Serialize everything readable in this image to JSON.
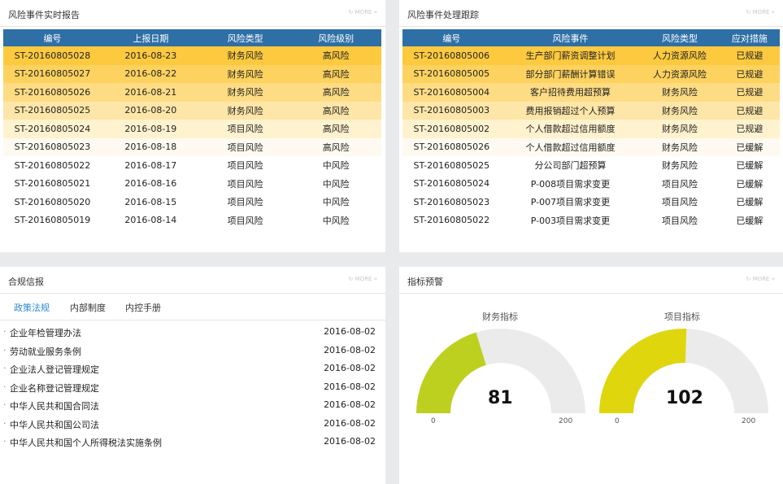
{
  "colors": {
    "header_bg": "#2e6fa6",
    "row_shades": [
      "#fcc93f",
      "#fdd25e",
      "#fedc84",
      "#fee6a8",
      "#fff2cf",
      "#fffaf1"
    ],
    "gauge_finance": "#bed01f",
    "gauge_project": "#dfd60e",
    "gauge_track": "#ebebeb"
  },
  "more_label": "MORE",
  "risk_report": {
    "title": "风险事件实时报告",
    "columns": [
      "编号",
      "上报日期",
      "风险类型",
      "风险级别"
    ],
    "rows": [
      [
        "ST-20160805028",
        "2016-08-23",
        "财务风险",
        "高风险"
      ],
      [
        "ST-20160805027",
        "2016-08-22",
        "财务风险",
        "高风险"
      ],
      [
        "ST-20160805026",
        "2016-08-21",
        "财务风险",
        "高风险"
      ],
      [
        "ST-20160805025",
        "2016-08-20",
        "财务风险",
        "高风险"
      ],
      [
        "ST-20160805024",
        "2016-08-19",
        "项目风险",
        "高风险"
      ],
      [
        "ST-20160805023",
        "2016-08-18",
        "项目风险",
        "高风险"
      ],
      [
        "ST-20160805022",
        "2016-08-17",
        "项目风险",
        "中风险"
      ],
      [
        "ST-20160805021",
        "2016-08-16",
        "项目风险",
        "中风险"
      ],
      [
        "ST-20160805020",
        "2016-08-15",
        "项目风险",
        "中风险"
      ],
      [
        "ST-20160805019",
        "2016-08-14",
        "项目风险",
        "中风险"
      ]
    ]
  },
  "risk_tracking": {
    "title": "风险事件处理跟踪",
    "columns": [
      "编号",
      "风险事件",
      "风险类型",
      "应对措施"
    ],
    "rows": [
      [
        "ST-20160805006",
        "生产部门薪资调整计划",
        "人力资源风险",
        "已规避"
      ],
      [
        "ST-20160805005",
        "部分部门薪酬计算错误",
        "人力资源风险",
        "已规避"
      ],
      [
        "ST-20160805004",
        "客户招待费用超预算",
        "财务风险",
        "已规避"
      ],
      [
        "ST-20160805003",
        "费用报销超过个人预算",
        "财务风险",
        "已规避"
      ],
      [
        "ST-20160805002",
        "个人借款超过信用额度",
        "财务风险",
        "已规避"
      ],
      [
        "ST-20160805026",
        "个人借款超过信用额度",
        "财务风险",
        "已缓解"
      ],
      [
        "ST-20160805025",
        "分公司部门超预算",
        "财务风险",
        "已缓解"
      ],
      [
        "ST-20160805024",
        "P-008项目需求变更",
        "项目风险",
        "已缓解"
      ],
      [
        "ST-20160805023",
        "P-007项目需求变更",
        "项目风险",
        "已缓解"
      ],
      [
        "ST-20160805022",
        "P-003项目需求变更",
        "项目风险",
        "已缓解"
      ]
    ]
  },
  "compliance": {
    "title": "合规信报",
    "tabs": [
      "政策法规",
      "内部制度",
      "内控手册"
    ],
    "items": [
      {
        "name": "企业年检管理办法",
        "date": "2016-08-02"
      },
      {
        "name": "劳动就业服务条例",
        "date": "2016-08-02"
      },
      {
        "name": "企业法人登记管理规定",
        "date": "2016-08-02"
      },
      {
        "name": "企业名称登记管理规定",
        "date": "2016-08-02"
      },
      {
        "name": "中华人民共和国合同法",
        "date": "2016-08-02"
      },
      {
        "name": "中华人民共和国公司法",
        "date": "2016-08-02"
      },
      {
        "name": "中华人民共和国个人所得税法实施条例",
        "date": "2016-08-02"
      }
    ]
  },
  "indicators": {
    "title": "指标预警",
    "gauges": [
      {
        "label": "财务指标",
        "value": 81,
        "min": 0,
        "max": 200
      },
      {
        "label": "项目指标",
        "value": 102,
        "min": 0,
        "max": 200
      }
    ]
  }
}
